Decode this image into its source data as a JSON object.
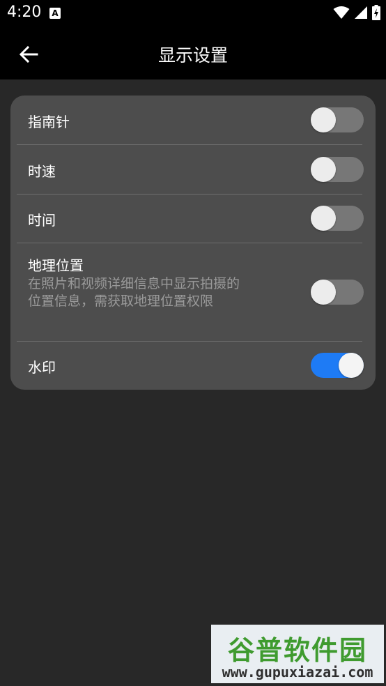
{
  "status_bar": {
    "time": "4:20",
    "notification_icon": "A",
    "icons": [
      "wifi-icon",
      "signal-icon",
      "battery-charging-icon"
    ]
  },
  "app_bar": {
    "back_icon": "arrow-left-icon",
    "title": "显示设置"
  },
  "settings": [
    {
      "label": "指南针",
      "enabled": false
    },
    {
      "label": "时速",
      "enabled": false
    },
    {
      "label": "时间",
      "enabled": false
    },
    {
      "label": "地理位置",
      "description": "在照片和视频详细信息中显示拍摄的位置信息，需获取地理位置权限",
      "enabled": false
    },
    {
      "label": "水印",
      "enabled": true
    }
  ],
  "colors": {
    "toggle_on": "#1e7bf5",
    "toggle_off": "#777777",
    "card": "#4d4d4d",
    "background": "#282828"
  },
  "watermark": {
    "brand": "谷普软件园",
    "url": "www.gupuxiazai.com"
  }
}
